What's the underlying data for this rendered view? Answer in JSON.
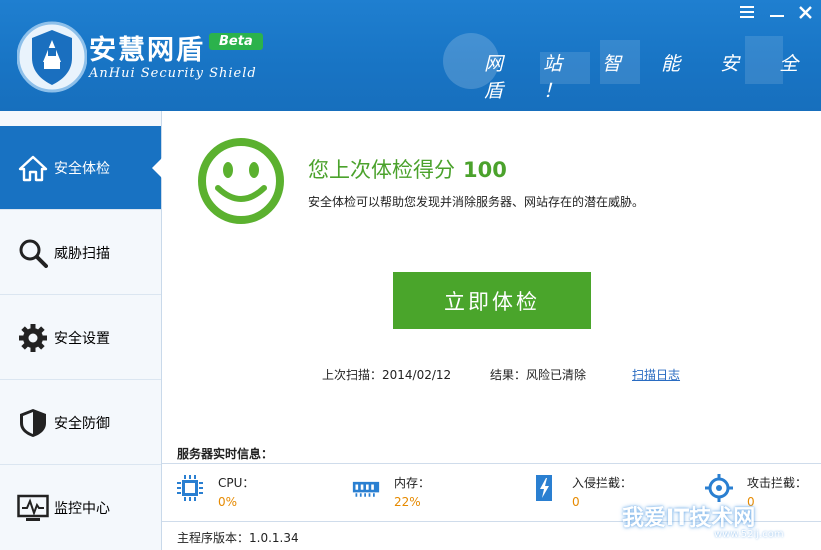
{
  "header": {
    "app_title": "安慧网盾",
    "beta_badge": "Beta",
    "app_subtitle": "AnHui Security Shield",
    "slogan": "网 站 智 能 安 全 盾 ！"
  },
  "sidebar": {
    "items": [
      {
        "label": "安全体检",
        "icon": "home-icon",
        "active": true
      },
      {
        "label": "威胁扫描",
        "icon": "magnifier-icon",
        "active": false
      },
      {
        "label": "安全设置",
        "icon": "gear-icon",
        "active": false
      },
      {
        "label": "安全防御",
        "icon": "shield-icon",
        "active": false
      },
      {
        "label": "监控中心",
        "icon": "monitor-icon",
        "active": false
      }
    ]
  },
  "main": {
    "score_label": "您上次体检得分",
    "score_value": "100",
    "description": "安全体检可以帮助您发现并消除服务器、网站存在的潜在威胁。",
    "scan_button": "立即体检",
    "last_scan": "上次扫描：2014/02/12",
    "result": "结果：风险已清除",
    "log_link": "扫描日志"
  },
  "server_info": {
    "title": "服务器实时信息：",
    "stats": [
      {
        "label": "CPU：",
        "value": "0%",
        "icon": "cpu-icon"
      },
      {
        "label": "内存：",
        "value": "22%",
        "icon": "memory-icon"
      },
      {
        "label": "入侵拦截：",
        "value": "0",
        "icon": "lightning-icon"
      },
      {
        "label": "攻击拦截：",
        "value": "0",
        "icon": "target-icon"
      }
    ]
  },
  "footer": {
    "version": "主程序版本：1.0.1.34"
  },
  "watermark": {
    "text": "我爱IT技术网",
    "url": "www.52ij.com"
  },
  "colors": {
    "header_blue": "#1874c4",
    "accent_green": "#4aa52b",
    "value_orange": "#e68a00"
  }
}
